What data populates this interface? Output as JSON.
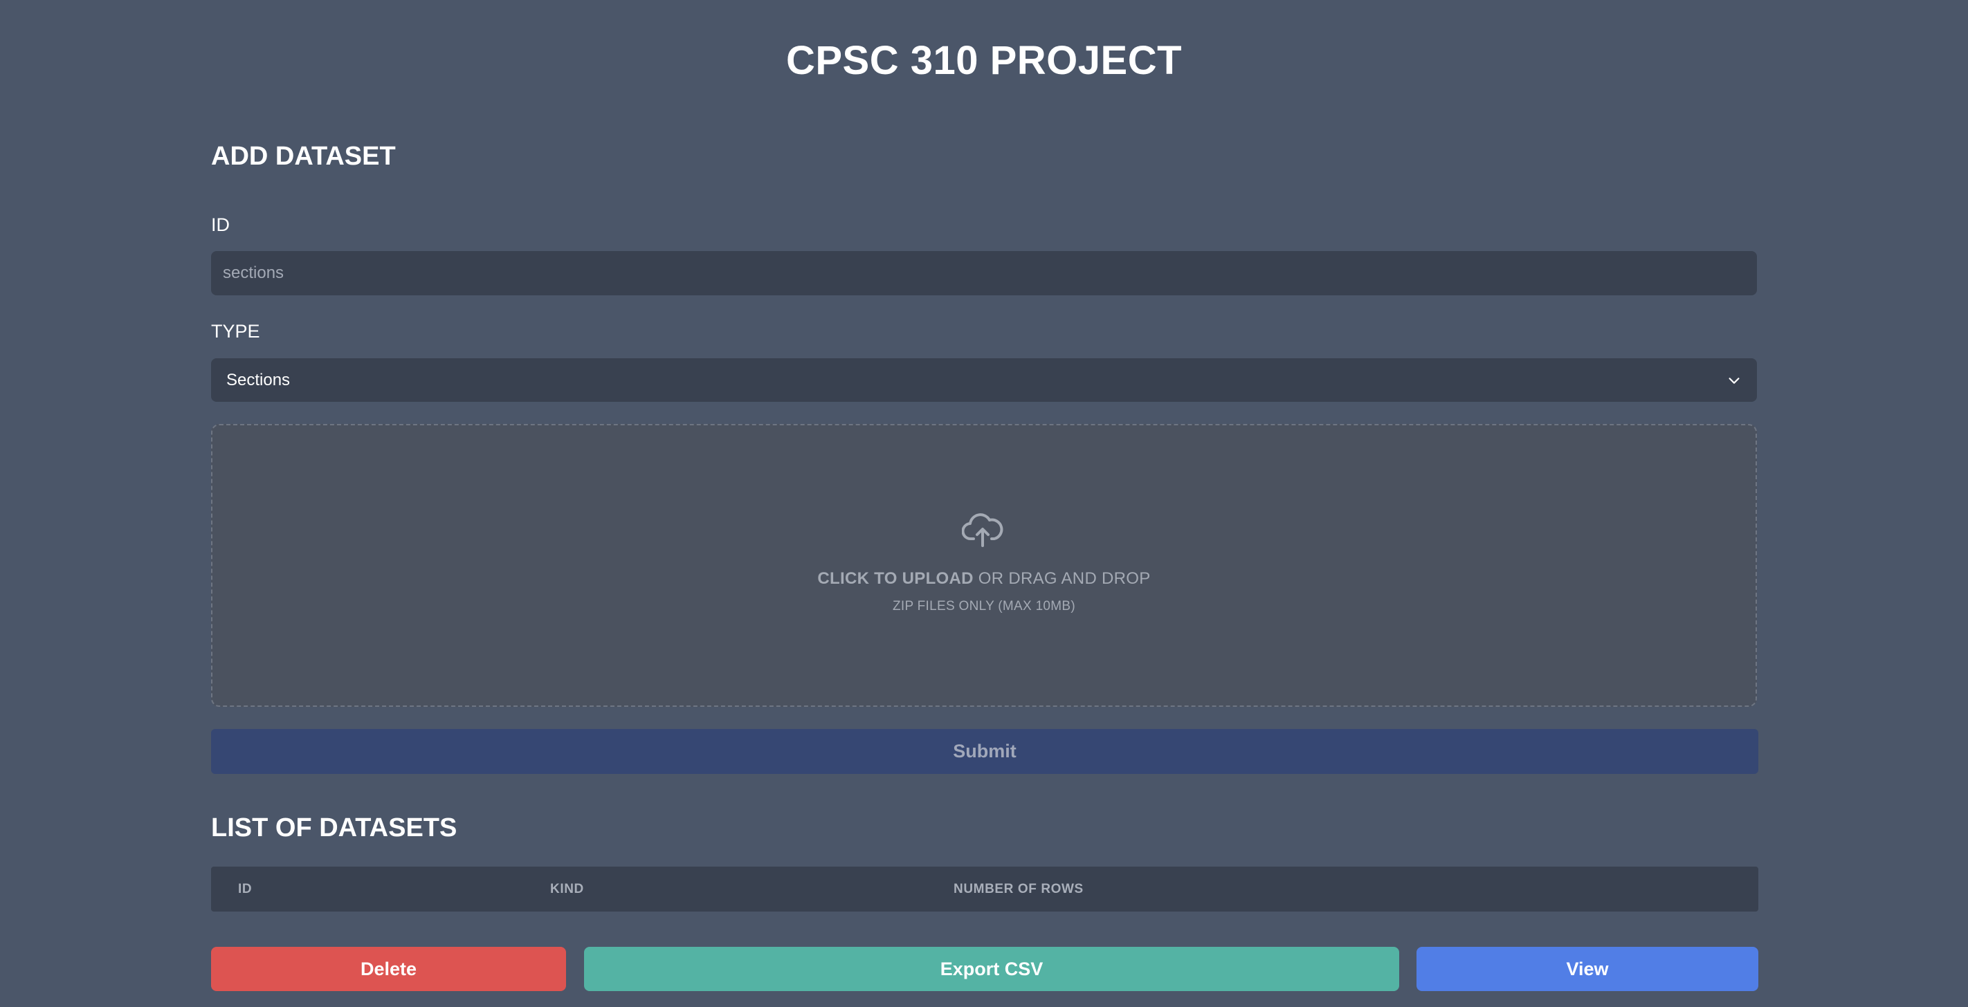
{
  "app": {
    "title": "CPSC 310 PROJECT"
  },
  "add_dataset": {
    "heading": "ADD DATASET",
    "id_field": {
      "label": "ID",
      "value": "",
      "placeholder": "sections"
    },
    "type_field": {
      "label": "TYPE",
      "selected": "Sections",
      "icon": "chevron-down-icon"
    },
    "upload": {
      "icon": "cloud-upload-icon",
      "click_text": "CLICK TO UPLOAD",
      "drag_text": "OR DRAG AND DROP",
      "hint": "ZIP FILES ONLY (MAX 10MB)"
    },
    "submit_label": "Submit"
  },
  "datasets": {
    "heading": "LIST OF DATASETS",
    "columns": [
      "ID",
      "KIND",
      "NUMBER OF ROWS"
    ],
    "rows": []
  },
  "actions": {
    "delete_label": "Delete",
    "export_label": "Export CSV",
    "view_label": "View"
  },
  "colors": {
    "background": "#4b5669",
    "input_background": "#394150",
    "submit": "#364773",
    "delete": "#dd5451",
    "export": "#54b3a4",
    "view": "#517ee6"
  }
}
